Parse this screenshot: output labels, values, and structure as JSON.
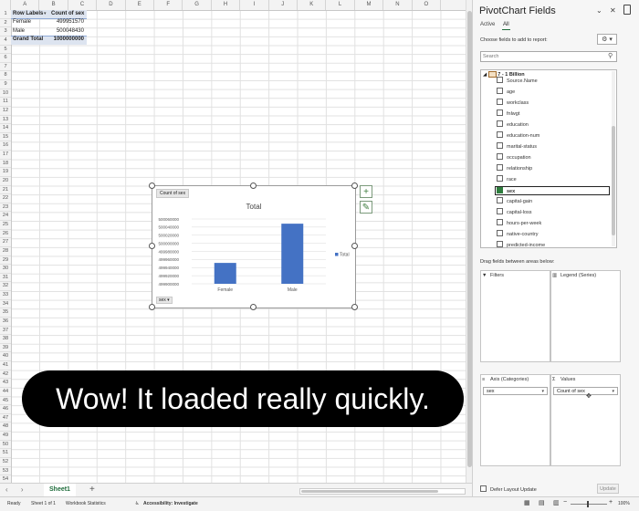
{
  "sheet": {
    "columns": [
      "A",
      "B",
      "C",
      "D",
      "E",
      "F",
      "G",
      "H",
      "I",
      "J",
      "K",
      "L",
      "M",
      "N",
      "O"
    ],
    "rows": [
      "1",
      "2",
      "3",
      "4",
      "5",
      "6",
      "7",
      "8",
      "9",
      "10",
      "11",
      "12",
      "13",
      "14",
      "15",
      "16",
      "17",
      "18",
      "19",
      "20",
      "21",
      "22",
      "23",
      "24",
      "25",
      "26",
      "27",
      "28",
      "29",
      "30",
      "31",
      "32",
      "33",
      "34",
      "35",
      "36",
      "37",
      "38",
      "39",
      "40",
      "41",
      "42",
      "43",
      "44",
      "45",
      "46",
      "47",
      "48",
      "49",
      "50",
      "51",
      "52",
      "53",
      "54"
    ],
    "pivot": {
      "header_row_labels": "Row Labels",
      "header_count": "Count of sex",
      "rows": [
        {
          "label": "Female",
          "value": "499951570"
        },
        {
          "label": "Male",
          "value": "500048430"
        }
      ],
      "total_label": "Grand Total",
      "total_value": "1000000000"
    }
  },
  "chart_data": {
    "type": "bar",
    "title": "Total",
    "categories": [
      "Female",
      "Male"
    ],
    "series": [
      {
        "name": "Total",
        "values": [
          499951570,
          500048430
        ]
      }
    ],
    "ylim": [
      499900000,
      500060000
    ],
    "yticks": [
      "500060000",
      "500040000",
      "500020000",
      "500000000",
      "499980000",
      "499960000",
      "499940000",
      "499920000",
      "499900000"
    ],
    "ytick_values": [
      500060000,
      500040000,
      500020000,
      500000000,
      499980000,
      499960000,
      499940000,
      499920000,
      499900000
    ],
    "legend": "right",
    "grid": true,
    "color": "#4472c4",
    "field_button": "Count of sex",
    "axis_button": "sex"
  },
  "caption": "Wow! It loaded really quickly.",
  "tabs": {
    "sheet1": "Sheet1",
    "add": "+",
    "nav": "‹ ›"
  },
  "status": {
    "ready": "Ready",
    "sheet_count": "Sheet 1 of 1",
    "workbook_stats": "Workbook Statistics",
    "accessibility": "Accessibility: Investigate",
    "zoom": "100%"
  },
  "panel": {
    "title": "PivotChart Fields",
    "tab_active": "Active",
    "tab_all": "All",
    "choose_label": "Choose fields to add to report:",
    "search_placeholder": "Search",
    "table_name": "7 - 1 Billion",
    "fields": [
      {
        "name": "Source.Name",
        "checked": false
      },
      {
        "name": "age",
        "checked": false
      },
      {
        "name": "workclass",
        "checked": false
      },
      {
        "name": "fnlwgt",
        "checked": false
      },
      {
        "name": "education",
        "checked": false
      },
      {
        "name": "education-num",
        "checked": false
      },
      {
        "name": "marital-status",
        "checked": false
      },
      {
        "name": "occupation",
        "checked": false
      },
      {
        "name": "relationship",
        "checked": false
      },
      {
        "name": "race",
        "checked": false
      },
      {
        "name": "sex",
        "checked": true
      },
      {
        "name": "capital-gain",
        "checked": false
      },
      {
        "name": "capital-loss",
        "checked": false
      },
      {
        "name": "hours-per-week",
        "checked": false
      },
      {
        "name": "native-country",
        "checked": false
      },
      {
        "name": "predicted-income",
        "checked": false
      }
    ],
    "drag_label": "Drag fields between areas below:",
    "areas": {
      "filters": "Filters",
      "legend": "Legend (Series)",
      "axis": "Axis (Categories)",
      "values": "Values",
      "axis_value": "sex",
      "values_value": "Count of sex"
    },
    "defer_label": "Defer Layout Update",
    "update_label": "Update"
  },
  "colors": {
    "accent_green": "#1e6b3a",
    "bar_blue": "#4472c4"
  }
}
